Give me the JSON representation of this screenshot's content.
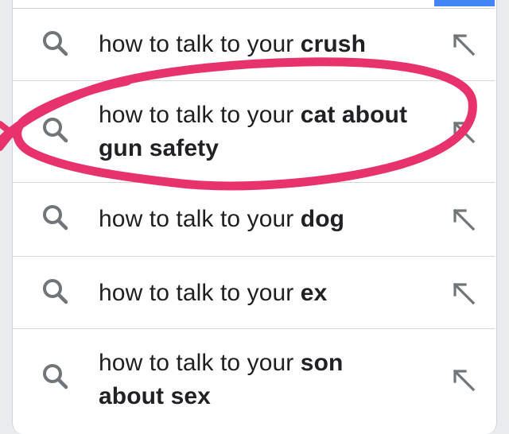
{
  "suggestions": [
    {
      "prefix": "how to talk to your",
      "bold_line1": "crush",
      "line2": ""
    },
    {
      "prefix": "how to talk to your",
      "bold_line1": "cat about",
      "line2": "gun safety"
    },
    {
      "prefix": "how to talk to your",
      "bold_line1": "dog",
      "line2": ""
    },
    {
      "prefix": "how to talk to your",
      "bold_line1": "ex",
      "line2": ""
    },
    {
      "prefix": "how to talk to your",
      "bold_line1": "son",
      "line2": "about sex"
    }
  ],
  "icons": {
    "search": "search-icon",
    "fill_query": "arrow-up-left-icon"
  },
  "colors": {
    "accent": "#4285f4",
    "annotation": "#e8326b",
    "icon_gray": "#70757a"
  }
}
